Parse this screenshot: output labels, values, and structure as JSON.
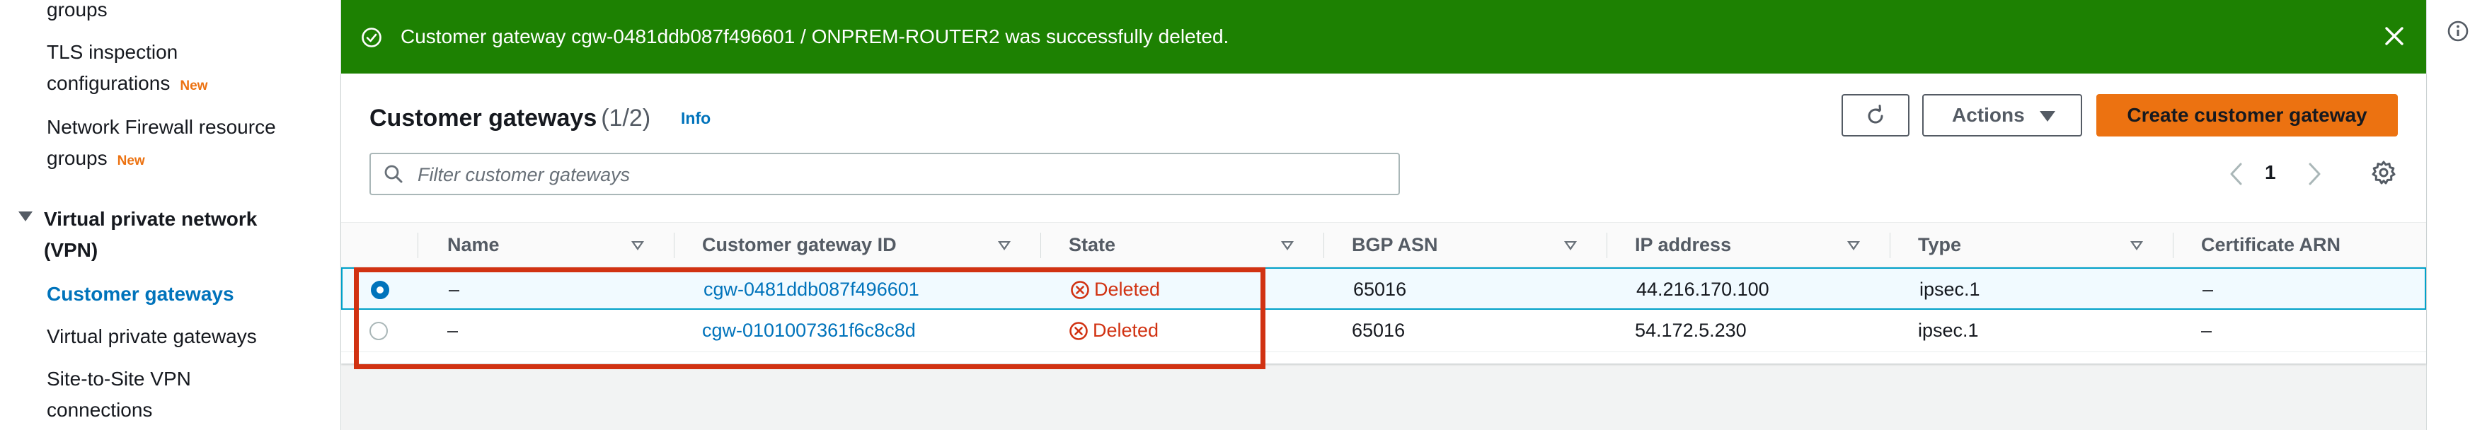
{
  "sidebar": {
    "items": [
      {
        "label": "groups"
      },
      {
        "label_line1": "TLS inspection",
        "label_line2": "configurations",
        "badge": "New"
      },
      {
        "label_line1": "Network Firewall resource",
        "label_line2": "groups",
        "badge": "New"
      }
    ],
    "section": {
      "label_line1": "Virtual private network",
      "label_line2": "(VPN)"
    },
    "vpn_items": [
      {
        "label": "Customer gateways",
        "active": true
      },
      {
        "label": "Virtual private gateways"
      },
      {
        "label_line1": "Site-to-Site VPN",
        "label_line2": "connections"
      }
    ]
  },
  "flash": {
    "message": "Customer gateway cgw-0481ddb087f496601 / ONPREM-ROUTER2 was successfully deleted.",
    "type": "success",
    "color": "#1d8102"
  },
  "header": {
    "title": "Customer gateways",
    "count": "(1/2)",
    "info_link": "Info",
    "actions_label": "Actions",
    "create_label": "Create customer gateway"
  },
  "filter": {
    "placeholder": "Filter customer gateways",
    "value": ""
  },
  "pagination": {
    "current_page": "1"
  },
  "table": {
    "columns": [
      "Name",
      "Customer gateway ID",
      "State",
      "BGP ASN",
      "IP address",
      "Type",
      "Certificate ARN"
    ],
    "rows": [
      {
        "selected": true,
        "name": "–",
        "id": "cgw-0481ddb087f496601",
        "state": "Deleted",
        "bgp_asn": "65016",
        "ip": "44.216.170.100",
        "type": "ipsec.1",
        "cert_arn": "–"
      },
      {
        "selected": false,
        "name": "–",
        "id": "cgw-0101007361f6c8c8d",
        "state": "Deleted",
        "bgp_asn": "65016",
        "ip": "54.172.5.230",
        "type": "ipsec.1",
        "cert_arn": "–"
      }
    ]
  },
  "colors": {
    "accent": "#0073bb",
    "primary_button": "#ec7211",
    "deleted": "#d13212",
    "annotation_box": "#d13212"
  },
  "icons": [
    "check-circle-icon",
    "close-icon",
    "refresh-icon",
    "caret-down-icon",
    "search-icon",
    "chevron-left-icon",
    "chevron-right-icon",
    "gear-icon",
    "x-circle-icon",
    "info-icon"
  ]
}
